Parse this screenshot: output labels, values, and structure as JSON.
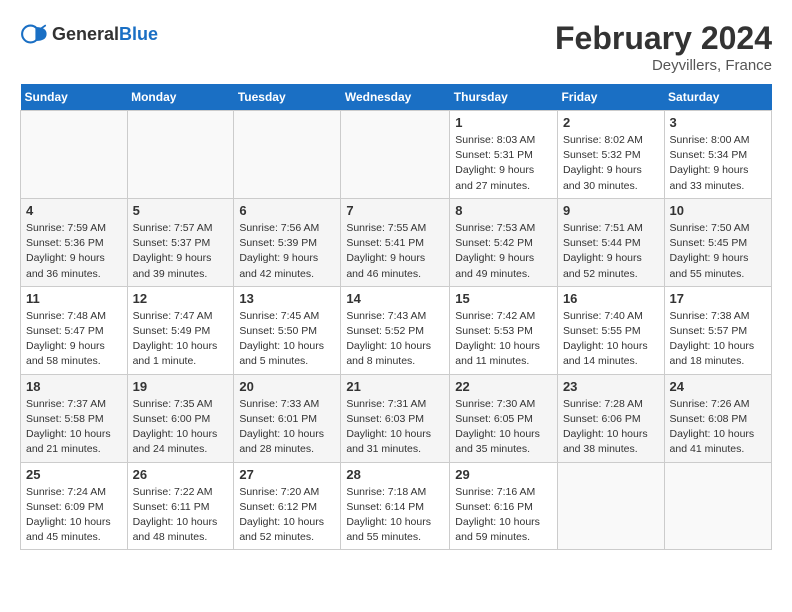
{
  "header": {
    "logo_general": "General",
    "logo_blue": "Blue",
    "month_year": "February 2024",
    "location": "Deyvillers, France"
  },
  "columns": [
    "Sunday",
    "Monday",
    "Tuesday",
    "Wednesday",
    "Thursday",
    "Friday",
    "Saturday"
  ],
  "weeks": [
    [
      {
        "day": "",
        "info": ""
      },
      {
        "day": "",
        "info": ""
      },
      {
        "day": "",
        "info": ""
      },
      {
        "day": "",
        "info": ""
      },
      {
        "day": "1",
        "info": "Sunrise: 8:03 AM\nSunset: 5:31 PM\nDaylight: 9 hours\nand 27 minutes."
      },
      {
        "day": "2",
        "info": "Sunrise: 8:02 AM\nSunset: 5:32 PM\nDaylight: 9 hours\nand 30 minutes."
      },
      {
        "day": "3",
        "info": "Sunrise: 8:00 AM\nSunset: 5:34 PM\nDaylight: 9 hours\nand 33 minutes."
      }
    ],
    [
      {
        "day": "4",
        "info": "Sunrise: 7:59 AM\nSunset: 5:36 PM\nDaylight: 9 hours\nand 36 minutes."
      },
      {
        "day": "5",
        "info": "Sunrise: 7:57 AM\nSunset: 5:37 PM\nDaylight: 9 hours\nand 39 minutes."
      },
      {
        "day": "6",
        "info": "Sunrise: 7:56 AM\nSunset: 5:39 PM\nDaylight: 9 hours\nand 42 minutes."
      },
      {
        "day": "7",
        "info": "Sunrise: 7:55 AM\nSunset: 5:41 PM\nDaylight: 9 hours\nand 46 minutes."
      },
      {
        "day": "8",
        "info": "Sunrise: 7:53 AM\nSunset: 5:42 PM\nDaylight: 9 hours\nand 49 minutes."
      },
      {
        "day": "9",
        "info": "Sunrise: 7:51 AM\nSunset: 5:44 PM\nDaylight: 9 hours\nand 52 minutes."
      },
      {
        "day": "10",
        "info": "Sunrise: 7:50 AM\nSunset: 5:45 PM\nDaylight: 9 hours\nand 55 minutes."
      }
    ],
    [
      {
        "day": "11",
        "info": "Sunrise: 7:48 AM\nSunset: 5:47 PM\nDaylight: 9 hours\nand 58 minutes."
      },
      {
        "day": "12",
        "info": "Sunrise: 7:47 AM\nSunset: 5:49 PM\nDaylight: 10 hours\nand 1 minute."
      },
      {
        "day": "13",
        "info": "Sunrise: 7:45 AM\nSunset: 5:50 PM\nDaylight: 10 hours\nand 5 minutes."
      },
      {
        "day": "14",
        "info": "Sunrise: 7:43 AM\nSunset: 5:52 PM\nDaylight: 10 hours\nand 8 minutes."
      },
      {
        "day": "15",
        "info": "Sunrise: 7:42 AM\nSunset: 5:53 PM\nDaylight: 10 hours\nand 11 minutes."
      },
      {
        "day": "16",
        "info": "Sunrise: 7:40 AM\nSunset: 5:55 PM\nDaylight: 10 hours\nand 14 minutes."
      },
      {
        "day": "17",
        "info": "Sunrise: 7:38 AM\nSunset: 5:57 PM\nDaylight: 10 hours\nand 18 minutes."
      }
    ],
    [
      {
        "day": "18",
        "info": "Sunrise: 7:37 AM\nSunset: 5:58 PM\nDaylight: 10 hours\nand 21 minutes."
      },
      {
        "day": "19",
        "info": "Sunrise: 7:35 AM\nSunset: 6:00 PM\nDaylight: 10 hours\nand 24 minutes."
      },
      {
        "day": "20",
        "info": "Sunrise: 7:33 AM\nSunset: 6:01 PM\nDaylight: 10 hours\nand 28 minutes."
      },
      {
        "day": "21",
        "info": "Sunrise: 7:31 AM\nSunset: 6:03 PM\nDaylight: 10 hours\nand 31 minutes."
      },
      {
        "day": "22",
        "info": "Sunrise: 7:30 AM\nSunset: 6:05 PM\nDaylight: 10 hours\nand 35 minutes."
      },
      {
        "day": "23",
        "info": "Sunrise: 7:28 AM\nSunset: 6:06 PM\nDaylight: 10 hours\nand 38 minutes."
      },
      {
        "day": "24",
        "info": "Sunrise: 7:26 AM\nSunset: 6:08 PM\nDaylight: 10 hours\nand 41 minutes."
      }
    ],
    [
      {
        "day": "25",
        "info": "Sunrise: 7:24 AM\nSunset: 6:09 PM\nDaylight: 10 hours\nand 45 minutes."
      },
      {
        "day": "26",
        "info": "Sunrise: 7:22 AM\nSunset: 6:11 PM\nDaylight: 10 hours\nand 48 minutes."
      },
      {
        "day": "27",
        "info": "Sunrise: 7:20 AM\nSunset: 6:12 PM\nDaylight: 10 hours\nand 52 minutes."
      },
      {
        "day": "28",
        "info": "Sunrise: 7:18 AM\nSunset: 6:14 PM\nDaylight: 10 hours\nand 55 minutes."
      },
      {
        "day": "29",
        "info": "Sunrise: 7:16 AM\nSunset: 6:16 PM\nDaylight: 10 hours\nand 59 minutes."
      },
      {
        "day": "",
        "info": ""
      },
      {
        "day": "",
        "info": ""
      }
    ]
  ]
}
